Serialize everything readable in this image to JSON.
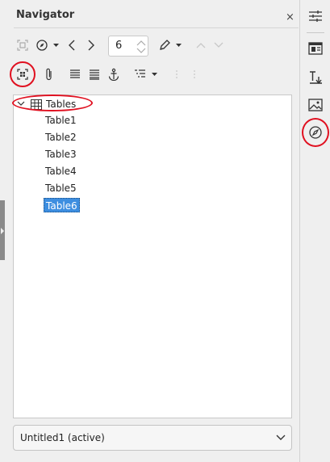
{
  "panel": {
    "title": "Navigator",
    "close_glyph": "×"
  },
  "toolbar": {
    "spin_value": "6",
    "icons_row1": [
      "toggle-content-icon",
      "navigate-by-icon",
      "previous-icon",
      "next-icon",
      "page-spin",
      "drag-mode-icon",
      "promote-icon",
      "demote-icon"
    ],
    "icons_row2": [
      "content-navigation-view-icon",
      "reminder-icon",
      "header-icon",
      "footer-icon",
      "anchor-icon",
      "heading-levels-icon",
      "promote-chapter-icon",
      "demote-chapter-icon"
    ]
  },
  "tree": {
    "root_label": "Tables",
    "items": [
      "Table1",
      "Table2",
      "Table3",
      "Table4",
      "Table5",
      "Table6"
    ],
    "selected_index": 5
  },
  "document_select": {
    "value": "Untitled1 (active)"
  },
  "sidebar": {
    "tabs": [
      "properties-icon",
      "page-icon",
      "styles-icon",
      "gallery-icon",
      "navigator-icon"
    ],
    "active": "navigator-icon"
  },
  "colors": {
    "selection": "#3d8ee0",
    "highlight_ring": "#e01020",
    "panel_bg": "#efefef"
  }
}
